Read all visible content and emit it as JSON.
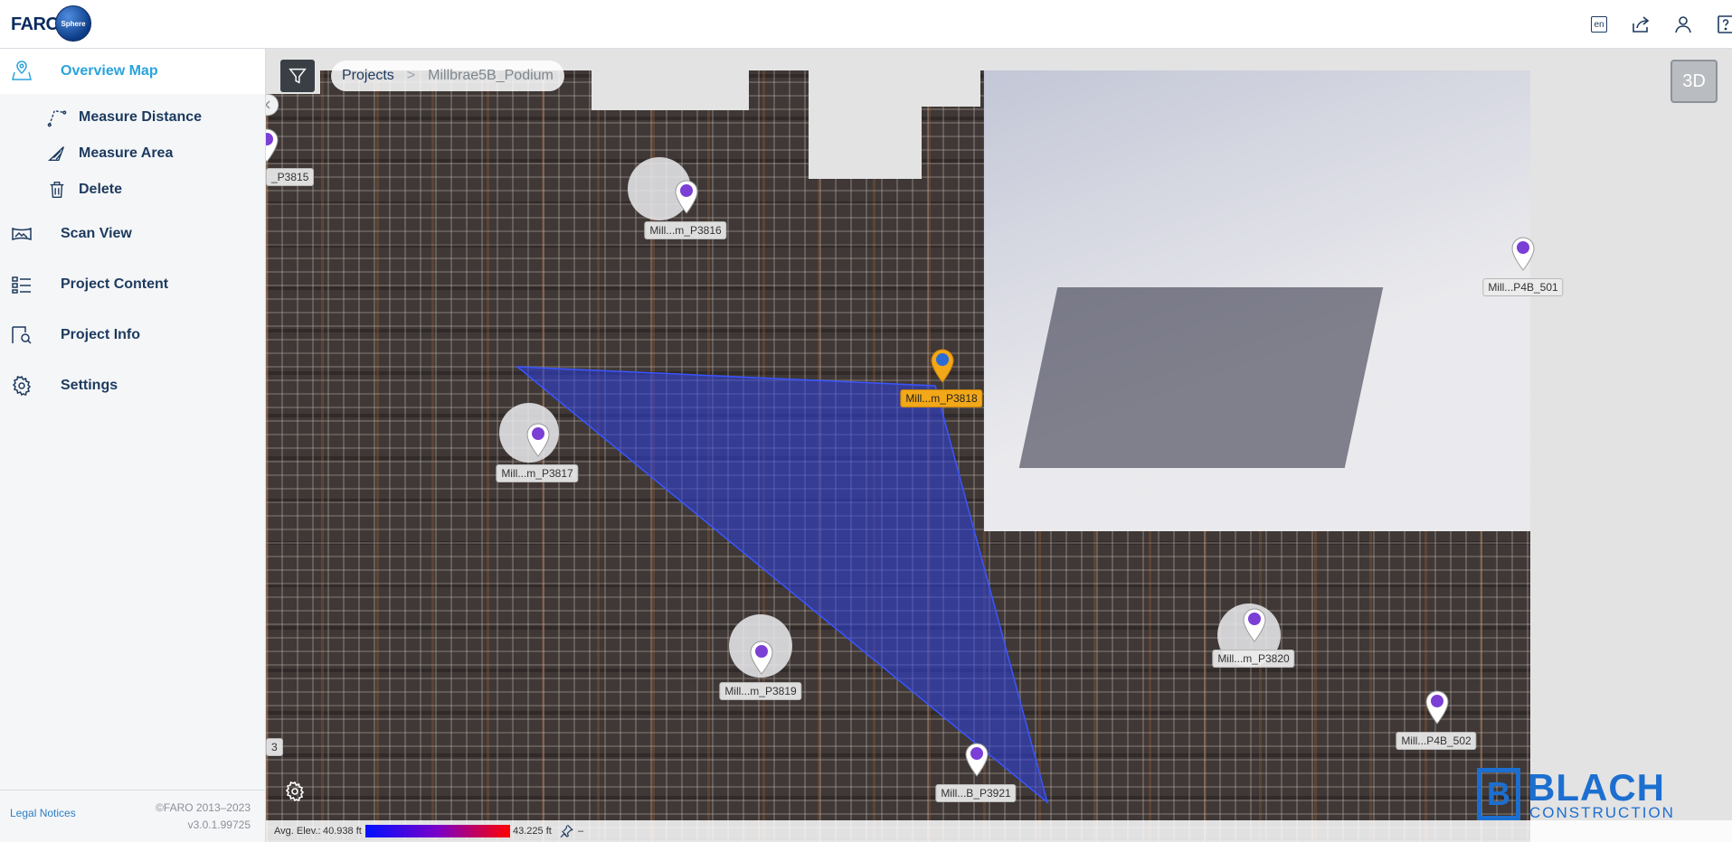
{
  "header": {
    "logo_text": "FARO",
    "logo_sub": "Sphere",
    "lang": "en"
  },
  "sidebar": {
    "items": [
      {
        "label": "Overview Map",
        "icon": "map-pin-icon",
        "active": true
      },
      {
        "label": "Scan View",
        "icon": "panorama-icon"
      },
      {
        "label": "Project Content",
        "icon": "list-icon"
      },
      {
        "label": "Project Info",
        "icon": "info-icon"
      },
      {
        "label": "Settings",
        "icon": "gear-icon"
      }
    ],
    "sub_items": [
      {
        "label": "Measure Distance",
        "icon": "measure-distance-icon"
      },
      {
        "label": "Measure Area",
        "icon": "measure-area-icon"
      },
      {
        "label": "Delete",
        "icon": "trash-icon"
      }
    ],
    "footer": {
      "legal": "Legal Notices",
      "copyright": "©FARO 2013–2023",
      "version": "v3.0.1.99725"
    }
  },
  "map": {
    "breadcrumb": {
      "root": "Projects",
      "current": "Millbrae5B_Podium"
    },
    "view_toggle": "3D",
    "pins": [
      {
        "label": "_P3815"
      },
      {
        "label": "Mill...m_P3816"
      },
      {
        "label": "Mill...P4B_501"
      },
      {
        "label": "Mill...m_P3818",
        "selected": true
      },
      {
        "label": "Mill...m_P3817"
      },
      {
        "label": "Mill...m_P3820"
      },
      {
        "label": "Mill...m_P3819"
      },
      {
        "label": "Mill...P4B_502"
      },
      {
        "label": "Mill...B_P3921"
      },
      {
        "label": "3"
      }
    ],
    "elevation": {
      "label": "Avg. Elev.:",
      "min": "40.938 ft",
      "max": "43.225 ft",
      "pinned": "–"
    },
    "watermark": {
      "name": "BLACH",
      "sub": "CONSTRUCTION",
      "mark": "B"
    },
    "colors": {
      "accent": "#2aa3dc",
      "selected_pin": "#f2a818",
      "pin": "#7b3fd6",
      "area": "#2d3fe0"
    }
  }
}
